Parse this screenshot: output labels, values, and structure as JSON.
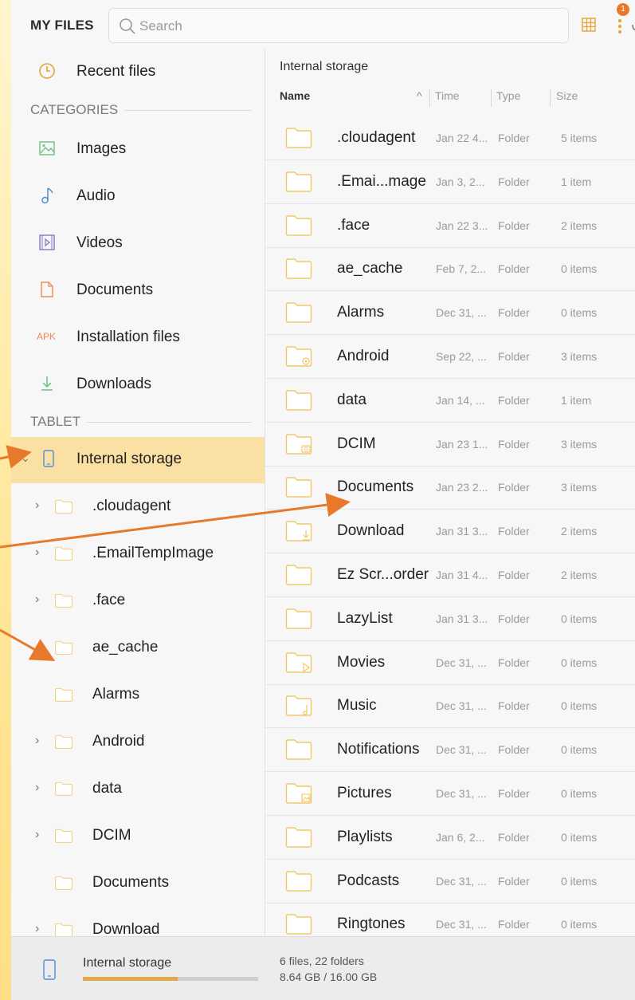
{
  "header": {
    "title": "MY FILES",
    "search_placeholder": "Search",
    "notification_count": "1"
  },
  "sidebar": {
    "recent_label": "Recent files",
    "categories_header": "CATEGORIES",
    "categories": [
      {
        "label": "Images",
        "icon": "image-icon"
      },
      {
        "label": "Audio",
        "icon": "music-note-icon"
      },
      {
        "label": "Videos",
        "icon": "video-icon"
      },
      {
        "label": "Documents",
        "icon": "document-icon"
      },
      {
        "label": "Installation files",
        "icon": "apk-icon",
        "icon_text": "APK"
      },
      {
        "label": "Downloads",
        "icon": "download-icon"
      }
    ],
    "tablet_header": "TABLET",
    "storage_label": "Internal storage",
    "tree": [
      {
        "label": ".cloudagent",
        "expandable": true
      },
      {
        "label": ".EmailTempImage",
        "expandable": true
      },
      {
        "label": ".face",
        "expandable": true
      },
      {
        "label": "ae_cache",
        "expandable": false
      },
      {
        "label": "Alarms",
        "expandable": false
      },
      {
        "label": "Android",
        "expandable": true
      },
      {
        "label": "data",
        "expandable": true
      },
      {
        "label": "DCIM",
        "expandable": true
      },
      {
        "label": "Documents",
        "expandable": false
      },
      {
        "label": "Download",
        "expandable": true
      }
    ]
  },
  "main": {
    "path": "Internal storage",
    "columns": {
      "name": "Name",
      "time": "Time",
      "type": "Type",
      "size": "Size"
    },
    "rows": [
      {
        "name": ".cloudagent",
        "time": "Jan 22 4...",
        "type": "Folder",
        "size": "5 items",
        "icon": "folder"
      },
      {
        "name": ".Emai...mage",
        "time": "Jan 3, 2...",
        "type": "Folder",
        "size": "1 item",
        "icon": "folder"
      },
      {
        "name": ".face",
        "time": "Jan 22 3...",
        "type": "Folder",
        "size": "2 items",
        "icon": "folder"
      },
      {
        "name": "ae_cache",
        "time": "Feb 7, 2...",
        "type": "Folder",
        "size": "0 items",
        "icon": "folder"
      },
      {
        "name": "Alarms",
        "time": "Dec 31, ...",
        "type": "Folder",
        "size": "0 items",
        "icon": "folder"
      },
      {
        "name": "Android",
        "time": "Sep 22, ...",
        "type": "Folder",
        "size": "3 items",
        "icon": "folder-gear"
      },
      {
        "name": "data",
        "time": "Jan 14, ...",
        "type": "Folder",
        "size": "1 item",
        "icon": "folder"
      },
      {
        "name": "DCIM",
        "time": "Jan 23 1...",
        "type": "Folder",
        "size": "3 items",
        "icon": "folder-camera"
      },
      {
        "name": "Documents",
        "time": "Jan 23 2...",
        "type": "Folder",
        "size": "3 items",
        "icon": "folder"
      },
      {
        "name": "Download",
        "time": "Jan 31 3...",
        "type": "Folder",
        "size": "2 items",
        "icon": "folder-download"
      },
      {
        "name": "Ez Scr...order",
        "time": "Jan 31 4...",
        "type": "Folder",
        "size": "2 items",
        "icon": "folder"
      },
      {
        "name": "LazyList",
        "time": "Jan 31 3...",
        "type": "Folder",
        "size": "0 items",
        "icon": "folder"
      },
      {
        "name": "Movies",
        "time": "Dec 31, ...",
        "type": "Folder",
        "size": "0 items",
        "icon": "folder-play"
      },
      {
        "name": "Music",
        "time": "Dec 31, ...",
        "type": "Folder",
        "size": "0 items",
        "icon": "folder-music"
      },
      {
        "name": "Notifications",
        "time": "Dec 31, ...",
        "type": "Folder",
        "size": "0 items",
        "icon": "folder"
      },
      {
        "name": "Pictures",
        "time": "Dec 31, ...",
        "type": "Folder",
        "size": "0 items",
        "icon": "folder-image"
      },
      {
        "name": "Playlists",
        "time": "Jan 6, 2...",
        "type": "Folder",
        "size": "0 items",
        "icon": "folder"
      },
      {
        "name": "Podcasts",
        "time": "Dec 31, ...",
        "type": "Folder",
        "size": "0 items",
        "icon": "folder"
      },
      {
        "name": "Ringtones",
        "time": "Dec 31, ...",
        "type": "Folder",
        "size": "0 items",
        "icon": "folder"
      }
    ]
  },
  "footer": {
    "storage_label": "Internal storage",
    "files_summary": "6 files, 22 folders",
    "capacity": "8.64 GB / 16.00 GB",
    "used_fraction": 0.54
  },
  "colors": {
    "accent": "#e8792b",
    "folder": "#f0c86a",
    "selected_bg": "#fbe0a3",
    "icon_green": "#6fbf7f",
    "icon_blue": "#4b8fd6",
    "icon_purple": "#8a77c4",
    "icon_orange": "#f08a57"
  }
}
